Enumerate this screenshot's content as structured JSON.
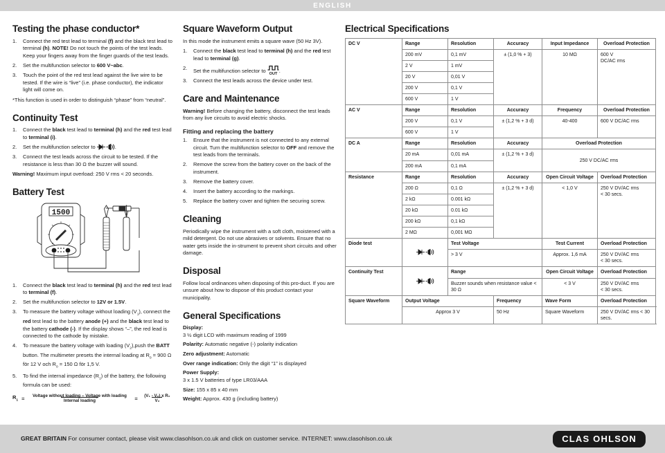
{
  "header": {
    "language": "ENGLISH"
  },
  "col_a": {
    "phase": {
      "title": "Testing the phase conductor*",
      "steps": [
        {
          "num": "1.",
          "html": "Connect the red test lead to terminal <b>(f)</b> and the black test lead to terminal <b>(h)</b>. <b>NOTE!</b> Do not touch the points of the test leads. Keep your fingers away from the finger guards of the test leads."
        },
        {
          "num": "2.",
          "html": "Set the multifunction selector to <b>600 V~abc</b>."
        },
        {
          "num": "3.",
          "html": "Touch the point of the red test lead against the live wire to be tested. If the wire is “live” (i.e. phase conductor), the indicator light will come on."
        }
      ],
      "footnote": "*This function is used in order to distinguish “phase” from “neutral”."
    },
    "continuity": {
      "title": "Continuity Test",
      "steps": [
        {
          "num": "1.",
          "html": "Connect the <b>black</b> test lead to <b>terminal (h)</b> and the <b>red</b> test lead to <b>terminal (i)</b>."
        },
        {
          "num": "2.",
          "html": "Set the multifunction selector to <icon-diode-buzzer>."
        },
        {
          "num": "3.",
          "html": "Connect the test leads across the circuit to be tested. If the resistance is less than 30 Ω the buzzer will sound."
        }
      ],
      "warning_label": "Warning!",
      "warning_text": "Maximum input overload: 250 V rms < 20 seconds."
    },
    "battery": {
      "title": "Battery Test",
      "figure_display": "1500",
      "steps": [
        {
          "num": "1.",
          "html": "Connect the <b>black</b> test lead to <b>terminal (h)</b> and the <b>red</b> test lead to <b>terminal (f)</b>."
        },
        {
          "num": "2.",
          "html": "Set the multifunction selector to <b>12V or 1.5V</b>."
        },
        {
          "num": "3.",
          "html": "To measure the battery voltage without loading (V<sub>1</sub>), connect the <b>red</b> test lead to the battery <b>anode (+)</b> and the <b>black</b> test lead to the battery <b>cathode (-)</b>. If the display shows “–”, the red lead is connected to the cathode by mistake."
        },
        {
          "num": "4.",
          "html": "To measure the battery voltage with loading (V<sub>2</sub>),push the <b>BATT</b> button. The multimeter presets the internal loading at R<sub>0</sub> = 900 Ω för 12 V och R<sub>0</sub> = 150 Ω för 1,5 V."
        },
        {
          "num": "5.",
          "html": "To find the internal impedance (R<sub>1</sub>) of the battery, the following formula can be used:"
        }
      ],
      "formula": {
        "lhs": "R",
        "lhs_sub": "1",
        "equals": "=",
        "num1": "Voltage without loading – Voltage with loading",
        "den1": "Internal loading",
        "equals2": "=",
        "num2": "(V₁ - V₂) x R₀",
        "den2": "V₂"
      }
    }
  },
  "col_b": {
    "square": {
      "title": "Square Waveform Output",
      "intro": "In this mode the instrument emits a square wave (50 Hz 3V).",
      "steps": [
        {
          "num": "1.",
          "html": "Connect the <b>black</b> test lead to <b>terminal (h)</b> and the <b>red</b> test lead to <b>terminal (g)</b>."
        },
        {
          "num": "2.",
          "html": "Set the multifunction selector to <icon-square-out>."
        },
        {
          "num": "3.",
          "html": "Connect the test leads across the device under test."
        }
      ]
    },
    "care": {
      "title": "Care and Maintenance",
      "warning_label": "Warning!",
      "warning_text": "Before changing the battery, disconnect the test leads from any live circuits to avoid electric shocks.",
      "battery_sub": "Fitting and replacing the battery",
      "steps": [
        {
          "num": "1.",
          "html": "Ensure that the instrument is not connected to any external circuit. Turn the multifunction selector to <b>OFF</b> and remove the test leads from the terminals."
        },
        {
          "num": "2.",
          "html": "Remove the screw from the battery cover on the back of the instrument."
        },
        {
          "num": "3.",
          "html": "Remove the battery cover."
        },
        {
          "num": "4.",
          "html": "Insert the battery according to the markings."
        },
        {
          "num": "5.",
          "html": "Replace the battery cover and tighten the securing screw."
        }
      ]
    },
    "cleaning": {
      "title": "Cleaning",
      "text": "Periodically wipe the instrument with a soft cloth, moistened with a mild detergent. Do not use abrasives or solvents. Ensure that no water gets inside the in-strument to prevent short circuits and other damage."
    },
    "disposal": {
      "title": "Disposal",
      "text": "Follow local ordinances when disposing of this pro-duct. If you are unsure about how to dispose of this product contact your municipality."
    },
    "general": {
      "title": "General Specifications",
      "items": [
        {
          "label": "Display:",
          "value": "3 ½ digit LCD with maximum reading of 1999",
          "block": true
        },
        {
          "label": "Polarity:",
          "value": "Automatic negative (-) polarity indication",
          "block": false
        },
        {
          "label": "Zero adjustment:",
          "value": "Automatic",
          "block": false
        },
        {
          "label": "Over range indication:",
          "value": "Only the digit “1” is displayed",
          "block": false
        },
        {
          "label": "Power Supply:",
          "value": "3 x 1.5 V batteries of type LR03/AAA",
          "block": true
        },
        {
          "label": "Size:",
          "value": "155 x 85 x 40 mm",
          "block": false
        },
        {
          "label": "Weight:",
          "value": "Approx. 430 g (including battery)",
          "block": false
        }
      ]
    }
  },
  "col_c": {
    "title": "Electrical Specifications",
    "table": {
      "dcv": {
        "group": "DC V",
        "headers": [
          "Range",
          "Resolution",
          "Accuracy",
          "Input Impedance",
          "Overload Protection"
        ],
        "rows": [
          [
            "200 mV",
            "0,1 mV"
          ],
          [
            "2 V",
            "1 mV"
          ],
          [
            "20 V",
            "0,01 V"
          ],
          [
            "200 V",
            "0,1 V"
          ],
          [
            "600 V",
            "1 V"
          ]
        ],
        "accuracy": "± (1,0 % + 3)",
        "impedance": "10 MΩ",
        "overload": "600 V\nDC/AC rms"
      },
      "acv": {
        "group": "AC V",
        "headers": [
          "Range",
          "Resolution",
          "Accuracy",
          "Frequency",
          "Overload Protection"
        ],
        "rows": [
          [
            "200 V",
            "0,1 V"
          ],
          [
            "600 V",
            "1 V"
          ]
        ],
        "accuracy": "± (1,2 % + 3 d)",
        "frequency": "40-400",
        "overload": "600 V DC/AC rms"
      },
      "dca": {
        "group": "DC A",
        "headers": [
          "Range",
          "Resolution",
          "Accuracy",
          "Overload Protection"
        ],
        "rows": [
          [
            "20 mA",
            "0,01 mA"
          ],
          [
            "200 mA",
            "0,1 mA"
          ]
        ],
        "accuracy": "± (1,2 % + 3 d)",
        "overload": "250 V DC/AC rms"
      },
      "resistance": {
        "group": "Resistance",
        "headers": [
          "Range",
          "Resolution",
          "Accuracy",
          "Open Circuit Voltage",
          "Overload Protection"
        ],
        "rows": [
          [
            "200 Ω",
            "0,1 Ω"
          ],
          [
            "2 kΩ",
            "0.001 kΩ"
          ],
          [
            "20 kΩ",
            "0.01 kΩ"
          ],
          [
            "200 kΩ",
            "0,1 kΩ"
          ],
          [
            "2 MΩ",
            "0,001 MΩ"
          ]
        ],
        "accuracy": "± (1,2 % + 3 d)",
        "open_circuit": "< 1,0 V",
        "overload": "250 V DV/AC rms\n< 30 secs."
      },
      "diode": {
        "group": "Diode test",
        "headers": [
          "Test Voltage",
          "Test Current",
          "Overload Protection"
        ],
        "test_voltage": "> 3 V",
        "test_current": "Approx. 1,6 mA",
        "overload": "250 V DV/AC rms\n< 30 secs."
      },
      "continuity": {
        "group": "Continuity Test",
        "headers": [
          "Range",
          "Open Circuit Voltage",
          "Overload Protection"
        ],
        "range": "Buzzer sounds when resistance value < 30 Ω",
        "open_circuit": "< 3 V",
        "overload": "250 V DV/AC rms\n< 30 secs."
      },
      "square": {
        "group": "Square Waveform",
        "headers": [
          "Output Voltage",
          "Frequency",
          "Wave Form",
          "Overload Protection"
        ],
        "output_voltage": "Approx 3 V",
        "frequency": "50 Hz",
        "wave_form": "Square Waveform",
        "overload": "250 V DV/AC rms < 30 secs."
      }
    }
  },
  "footer": {
    "country": "GREAT BRITAIN",
    "text": "For consumer contact, please visit www.clasohlson.co.uk and click on customer service. INTERNET: www.clasohlson.co.uk",
    "logo": "CLAS OHLSON"
  }
}
